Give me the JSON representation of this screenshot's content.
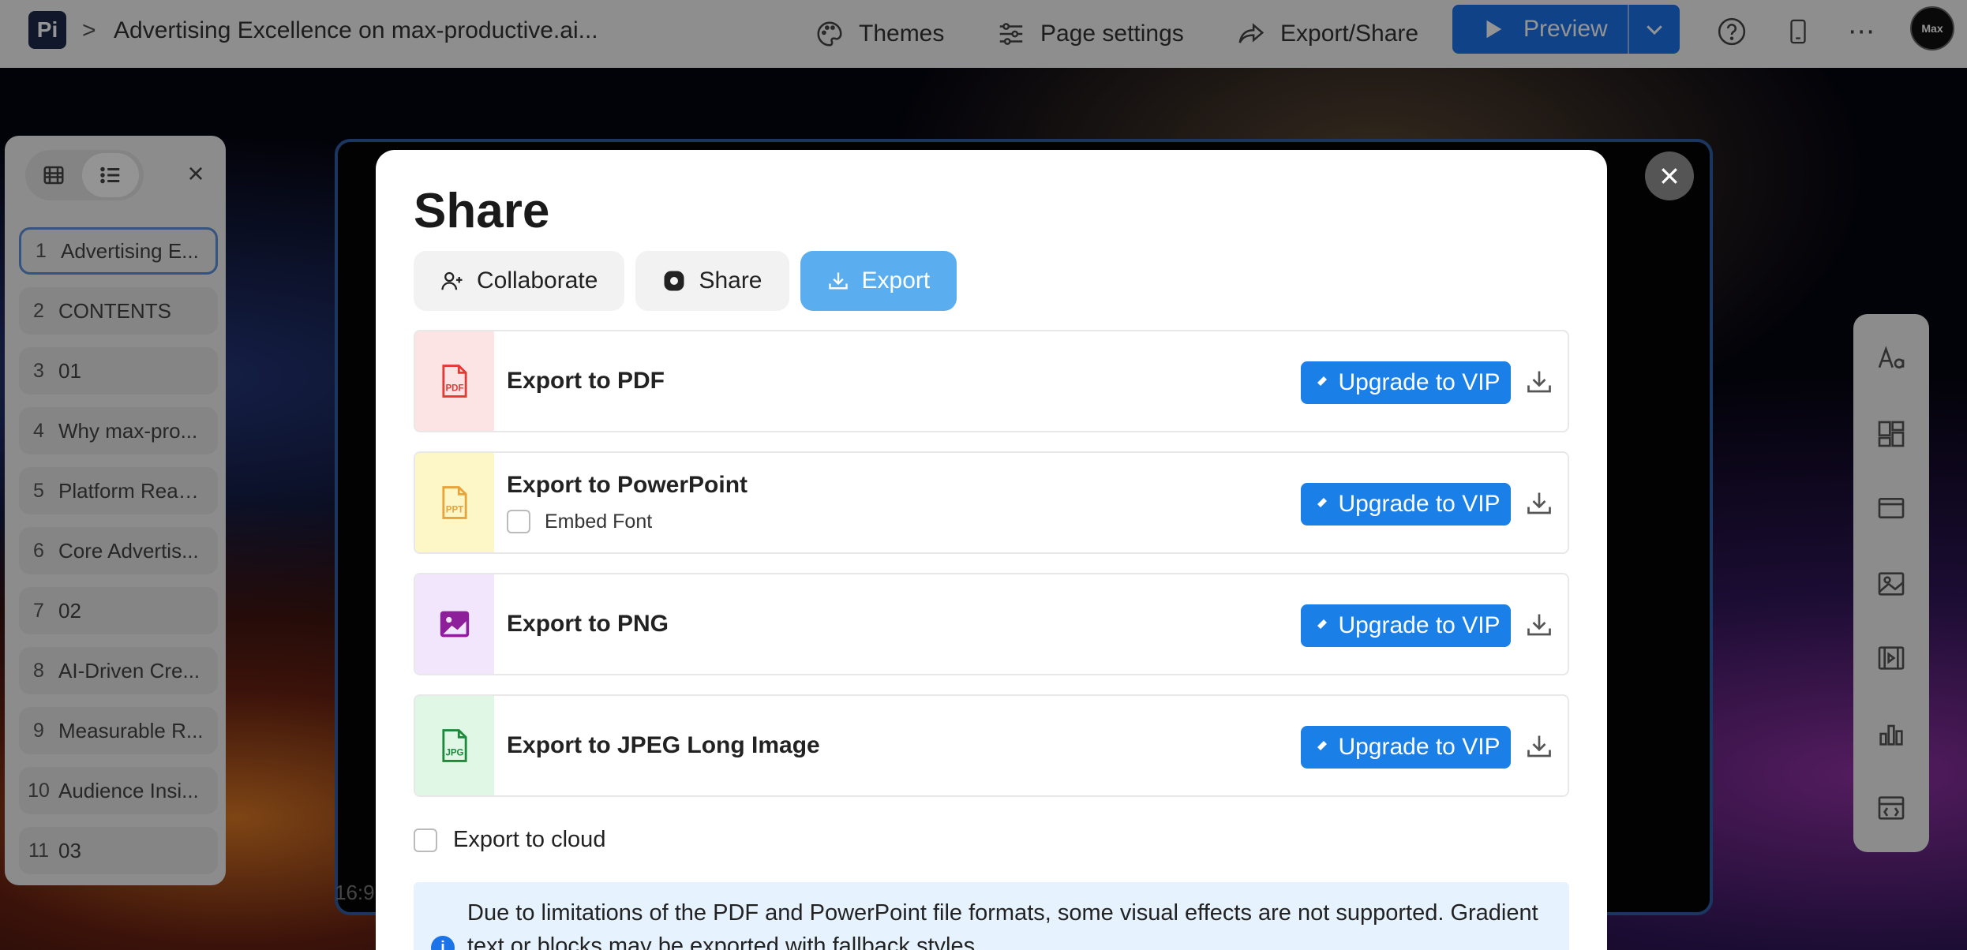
{
  "topbar": {
    "logo": "Pi",
    "crumb_separator": ">",
    "doc_title": "Advertising Excellence on max-productive.ai...",
    "themes": "Themes",
    "page_settings": "Page settings",
    "export_share": "Export/Share",
    "preview": "Preview",
    "help_icon": "?",
    "more_icon": "⋯",
    "avatar": "Max"
  },
  "slide_panel": {
    "slides": [
      {
        "num": "1",
        "label": "Advertising E..."
      },
      {
        "num": "2",
        "label": "CONTENTS"
      },
      {
        "num": "3",
        "label": "01"
      },
      {
        "num": "4",
        "label": "Why max-pro..."
      },
      {
        "num": "5",
        "label": "Platform Reac..."
      },
      {
        "num": "6",
        "label": "Core Advertis..."
      },
      {
        "num": "7",
        "label": "02"
      },
      {
        "num": "8",
        "label": "AI-Driven Cre..."
      },
      {
        "num": "9",
        "label": "Measurable R..."
      },
      {
        "num": "10",
        "label": "Audience Insi..."
      },
      {
        "num": "11",
        "label": "03"
      }
    ],
    "close": "×"
  },
  "slide": {
    "ratio": "16:9"
  },
  "modal": {
    "title": "Share",
    "tabs": [
      {
        "label": "Collaborate"
      },
      {
        "label": "Share"
      },
      {
        "label": "Export"
      }
    ],
    "exports": [
      {
        "label": "Export to PDF",
        "icon_text": "PDF",
        "button": "Upgrade to VIP",
        "color": "#e53935",
        "bg": "#fde4e4"
      },
      {
        "label": "Export to PowerPoint",
        "icon_text": "PPT",
        "button": "Upgrade to VIP",
        "embed_font": "Embed Font",
        "color": "#e8a33a",
        "bg": "#fdf7c8"
      },
      {
        "label": "Export to PNG",
        "button": "Upgrade to VIP",
        "color": "#8e1f9a",
        "bg": "#f1e6fb"
      },
      {
        "label": "Export to JPEG Long Image",
        "icon_text": "JPG",
        "button": "Upgrade to VIP",
        "color": "#1b8a3a",
        "bg": "#e0f7e6"
      }
    ],
    "cloud": "Export to cloud",
    "notice": "Due to limitations of the PDF and PowerPoint file formats, some visual effects are not supported. Gradient text or blocks may be exported with fallback styles.",
    "notice_icon": "i",
    "close": "×"
  },
  "colors": {
    "accent": "#1a73e8",
    "export_tab": "#5aaef0",
    "slide_frame": "#2f5fa8"
  }
}
